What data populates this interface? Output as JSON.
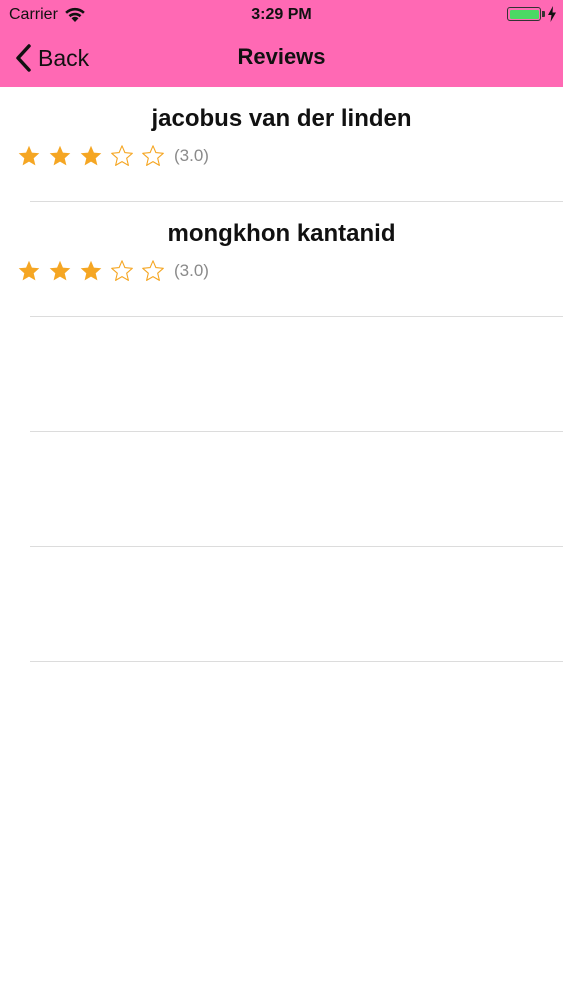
{
  "status_bar": {
    "carrier": "Carrier",
    "time": "3:29 PM",
    "battery_color": "#4cd964"
  },
  "nav": {
    "back_label": "Back",
    "title": "Reviews",
    "background": "#ff69b4"
  },
  "reviews": [
    {
      "name": "jacobus van der linden",
      "stars": 3,
      "max_stars": 5,
      "rating_text": "(3.0)"
    },
    {
      "name": "mongkhon kantanid",
      "stars": 3,
      "max_stars": 5,
      "rating_text": "(3.0)"
    }
  ],
  "empty_rows": 3,
  "star_color": "#f5a623",
  "icons": {
    "wifi": "wifi-icon",
    "battery": "battery-icon",
    "charging": "charging-bolt-icon",
    "back": "chevron-left-icon",
    "star_filled": "star-filled-icon",
    "star_empty": "star-outline-icon"
  }
}
